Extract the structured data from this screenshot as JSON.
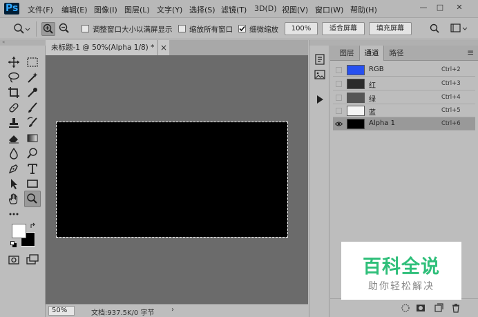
{
  "app": {
    "logo": "Ps"
  },
  "menu": {
    "items": [
      "文件(F)",
      "编辑(E)",
      "图像(I)",
      "图层(L)",
      "文字(Y)",
      "选择(S)",
      "滤镜(T)",
      "3D(D)",
      "视图(V)",
      "窗口(W)",
      "帮助(H)"
    ]
  },
  "window_controls": {
    "minimize": "—",
    "restore": "□",
    "close": "✕"
  },
  "options": {
    "resize_windows_label": "调整窗口大小以满屏显示",
    "resize_windows_checked": false,
    "zoom_all_label": "缩放所有窗口",
    "zoom_all_checked": false,
    "scrubby_label": "细微缩放",
    "scrubby_checked": true,
    "btn_100": "100%",
    "btn_fit": "适合屏幕",
    "btn_fill": "填充屏幕"
  },
  "document": {
    "tab_title": "未标题-1 @ 50%(Alpha 1/8) *",
    "tab_close": "×",
    "zoom": "50%",
    "status": "文档:937.5K/0 字节",
    "status_arrow": "›",
    "canvas_color": "#000000",
    "workspace_color": "#6b6b6b"
  },
  "panel": {
    "tabs": [
      "图层",
      "通道",
      "路径"
    ],
    "active_tab": "通道",
    "menu_icon": "≡",
    "channels": [
      {
        "name": "RGB",
        "shortcut": "Ctrl+2",
        "thumb": "#2750f0",
        "visible": false,
        "selected": false
      },
      {
        "name": "红",
        "shortcut": "Ctrl+3",
        "thumb": "#2b2b2b",
        "visible": false,
        "selected": false
      },
      {
        "name": "绿",
        "shortcut": "Ctrl+4",
        "thumb": "#555555",
        "visible": false,
        "selected": false
      },
      {
        "name": "蓝",
        "shortcut": "Ctrl+5",
        "thumb": "#f4f4f4",
        "visible": false,
        "selected": false
      },
      {
        "name": "Alpha 1",
        "shortcut": "Ctrl+6",
        "thumb": "#000000",
        "visible": true,
        "selected": true
      }
    ]
  },
  "watermark": {
    "title": "百科全说",
    "subtitle": "助你轻松解决"
  }
}
